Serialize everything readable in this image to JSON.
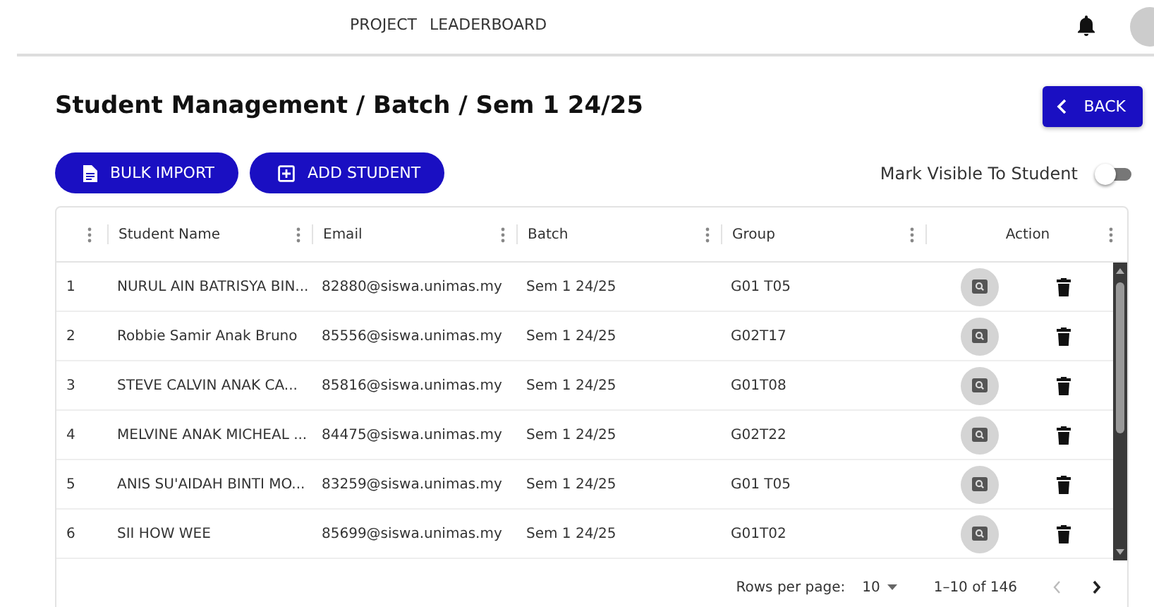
{
  "nav": {
    "links": [
      "PROJECT",
      "LEADERBOARD"
    ]
  },
  "title": "Student Management / Batch / Sem 1 24/25",
  "back_button": "BACK",
  "actions": [
    "BULK IMPORT",
    "ADD STUDENT"
  ],
  "visibility_toggle": {
    "label": "Mark Visible To Student",
    "on": false
  },
  "table": {
    "columns": [
      "Student Name",
      "Email",
      "Batch",
      "Group",
      "Action"
    ],
    "rows": [
      {
        "index": "1",
        "name": "NURUL AIN BATRISYA BIN...",
        "email": "82880@siswa.unimas.my",
        "batch": "Sem 1 24/25",
        "group": "G01 T05"
      },
      {
        "index": "2",
        "name": "Robbie Samir Anak Bruno",
        "email": "85556@siswa.unimas.my",
        "batch": "Sem 1 24/25",
        "group": "G02T17"
      },
      {
        "index": "3",
        "name": "STEVE CALVIN ANAK CA...",
        "email": "85816@siswa.unimas.my",
        "batch": "Sem 1 24/25",
        "group": "G01T08"
      },
      {
        "index": "4",
        "name": "MELVINE ANAK MICHEAL ...",
        "email": "84475@siswa.unimas.my",
        "batch": "Sem 1 24/25",
        "group": "G02T22"
      },
      {
        "index": "5",
        "name": "ANIS SU'AIDAH BINTI MO...",
        "email": "83259@siswa.unimas.my",
        "batch": "Sem 1 24/25",
        "group": "G01 T05"
      },
      {
        "index": "6",
        "name": "SII HOW WEE",
        "email": "85699@siswa.unimas.my",
        "batch": "Sem 1 24/25",
        "group": "G01T02"
      }
    ]
  },
  "pagination": {
    "rows_per_page_label": "Rows per page:",
    "rows_per_page": "10",
    "range": "1–10 of 146",
    "prev_disabled": true,
    "next_disabled": false
  }
}
